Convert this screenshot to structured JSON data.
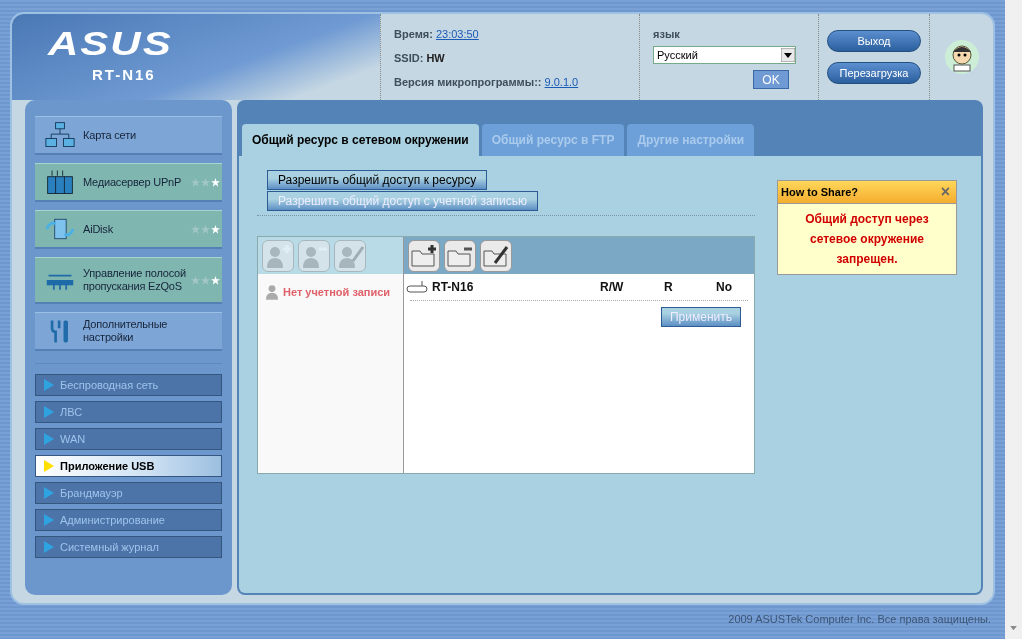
{
  "header": {
    "logo": "ASUS",
    "model": "RT-N16",
    "time_label": "Время:",
    "time": "23:03:50",
    "ssid_label": "SSID:",
    "ssid": "HW",
    "firmware_label": "Версия микропрограммы::",
    "firmware": "9.0.1.0",
    "language_label": "язык",
    "language": "Русский",
    "ok": "OK",
    "logout": "Выход",
    "reboot": "Перезагрузка"
  },
  "sidebar": {
    "items": [
      {
        "kind": "network",
        "label": "Карта сети",
        "highlighted": false
      },
      {
        "kind": "media",
        "label": "Медиасервер UPnP",
        "highlighted": true,
        "stars": 1
      },
      {
        "kind": "aidisk",
        "label": "AiDisk",
        "highlighted": true,
        "stars": 1
      },
      {
        "kind": "qos",
        "label": "Управление полосой пропускания EzQoS",
        "highlighted": true,
        "stars": 1
      },
      {
        "kind": "tools",
        "label": "Дополнительные настройки",
        "highlighted": false
      }
    ],
    "subitems": [
      {
        "label": "Беспроводная сеть",
        "selected": false
      },
      {
        "label": "ЛВС",
        "selected": false
      },
      {
        "label": "WAN",
        "selected": false
      },
      {
        "label": "Приложение USB",
        "selected": true
      },
      {
        "label": "Брандмауэр",
        "selected": false
      },
      {
        "label": "Администрирование",
        "selected": false
      },
      {
        "label": "Системный журнал",
        "selected": false
      }
    ]
  },
  "tabs": [
    {
      "label": "Общий ресурс в сетевом окружении",
      "selected": true
    },
    {
      "label": "Общий ресурс в FTP",
      "selected": false
    },
    {
      "label": "Другие настройки",
      "selected": false
    }
  ],
  "mode_buttons": [
    {
      "label": "Разрешить общий доступ к ресурсу",
      "selected": true
    },
    {
      "label": "Разрешить общий доступ с учетной записью",
      "selected": false
    }
  ],
  "account_tools": [
    {
      "kind": "user-add",
      "disabled": true
    },
    {
      "kind": "user-remove",
      "disabled": true
    },
    {
      "kind": "user-edit",
      "disabled": true
    }
  ],
  "folder_tools": [
    {
      "kind": "folder-add",
      "disabled": false
    },
    {
      "kind": "folder-remove",
      "disabled": false
    },
    {
      "kind": "folder-edit",
      "disabled": false
    }
  ],
  "accounts": [
    {
      "name": "Нет учетной записи"
    }
  ],
  "shares": [
    {
      "name": "RT-N16",
      "column_2": "R/W",
      "column_3": "R",
      "column_4": "No"
    }
  ],
  "apply": "Применить",
  "help": {
    "title": "How to Share?",
    "close": "×",
    "message": "Общий доступ через сетевое окружение запрещен."
  },
  "footer": "2009 ASUSTek Computer Inc. Все права защищены."
}
